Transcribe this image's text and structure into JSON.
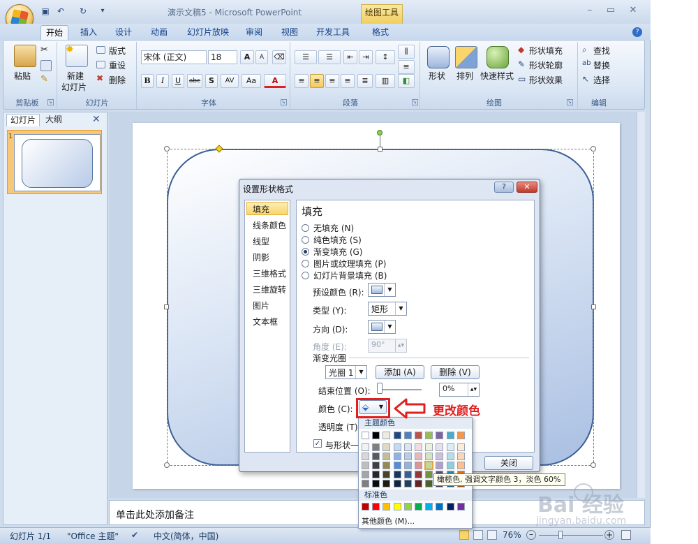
{
  "window": {
    "title": "演示文稿5 - Microsoft PowerPoint",
    "contextual_tool": "绘图工具",
    "controls": [
      "–",
      "▭",
      "✕"
    ]
  },
  "tabs": [
    "开始",
    "插入",
    "设计",
    "动画",
    "幻灯片放映",
    "审阅",
    "视图",
    "开发工具",
    "格式"
  ],
  "active_tab": "开始",
  "ribbon": {
    "clipboard": {
      "paste": "粘贴",
      "group": "剪贴板"
    },
    "slides": {
      "new_slide_line1": "新建",
      "new_slide_line2": "幻灯片",
      "layout": "版式",
      "reset": "重设",
      "delete": "删除",
      "group": "幻灯片"
    },
    "font": {
      "name": "宋体 (正文)",
      "size": "18",
      "group": "字体"
    },
    "paragraph": {
      "group": "段落"
    },
    "drawing": {
      "shape": "形状",
      "arrange": "排列",
      "quick_style": "快速样式",
      "fill": "形状填充",
      "outline": "形状轮廓",
      "effect": "形状效果",
      "group": "绘图"
    },
    "editing": {
      "find": "查找",
      "replace": "替换",
      "select": "选择",
      "group": "编辑"
    }
  },
  "left_pane": {
    "tab_slides": "幻灯片",
    "tab_outline": "大纲",
    "slide_number": "1"
  },
  "notes_placeholder": "单击此处添加备注",
  "status": {
    "slide": "幻灯片 1/1",
    "theme": "\"Office 主题\"",
    "language": "中文(简体，中国)",
    "zoom": "76%"
  },
  "dialog": {
    "title": "设置形状格式",
    "help": "?",
    "close_x": "✕",
    "nav": [
      "填充",
      "线条颜色",
      "线型",
      "阴影",
      "三维格式",
      "三维旋转",
      "图片",
      "文本框"
    ],
    "selected_nav": "填充",
    "heading": "填充",
    "radios": [
      "无填充 (N)",
      "纯色填充 (S)",
      "渐变填充 (G)",
      "图片或纹理填充 (P)",
      "幻灯片背景填充 (B)"
    ],
    "selected_radio": "渐变填充 (G)",
    "preset_label": "预设颜色 (R):",
    "type_label": "类型 (Y):",
    "type_value": "矩形",
    "direction_label": "方向 (D):",
    "angle_label": "角度 (E):",
    "angle_value": "90°",
    "stops_title": "渐变光圈",
    "stop_value": "光圈 1",
    "add_button": "添加 (A)",
    "delete_button": "删除 (V)",
    "end_pos_label": "结束位置 (O):",
    "end_pos_value": "0%",
    "end_pos_fraction": 0.0,
    "color_label": "颜色 (C):",
    "transparency_label": "透明度 (T):",
    "rotate_label": "与形状一",
    "close_button": "关闭"
  },
  "annotation": "更改颜色",
  "color_popup": {
    "theme_header": "主题颜色",
    "standard_header": "标准色",
    "more_colors": "其他颜色 (M)...",
    "tooltip": "橄榄色, 强调文字颜色 3，淡色 60%",
    "theme_top": [
      "#ffffff",
      "#000000",
      "#eeece1",
      "#1f497d",
      "#4f81bd",
      "#c0504d",
      "#9bbb59",
      "#8064a2",
      "#4bacc6",
      "#f79646"
    ],
    "theme_columns": [
      [
        "#f2f2f2",
        "#d8d8d8",
        "#bfbfbf",
        "#a5a5a5",
        "#7f7f7f"
      ],
      [
        "#7f7f7f",
        "#595959",
        "#3f3f3f",
        "#262626",
        "#0c0c0c"
      ],
      [
        "#ddd9c3",
        "#c4bd97",
        "#938953",
        "#494429",
        "#1d1b10"
      ],
      [
        "#c6d9f0",
        "#8db3e2",
        "#548dd4",
        "#17365d",
        "#0f243e"
      ],
      [
        "#dbe5f1",
        "#b8cce4",
        "#95b3d7",
        "#366092",
        "#244061"
      ],
      [
        "#f2dcdb",
        "#e5b9b7",
        "#d99694",
        "#953734",
        "#632423"
      ],
      [
        "#ebf1dd",
        "#d7e3bc",
        "#c3d69b",
        "#76923c",
        "#4f6128"
      ],
      [
        "#e5e0ec",
        "#ccc1d9",
        "#b2a2c7",
        "#5f497a",
        "#3f3151"
      ],
      [
        "#dbeef3",
        "#b7dde8",
        "#92cddc",
        "#31859b",
        "#205867"
      ],
      [
        "#fdeada",
        "#fbd5b5",
        "#fac08f",
        "#e36c09",
        "#974806"
      ]
    ],
    "standard": [
      "#c00000",
      "#ff0000",
      "#ffc000",
      "#ffff00",
      "#92d050",
      "#00b050",
      "#00b0f0",
      "#0070c0",
      "#002060",
      "#7030a0"
    ]
  },
  "watermark": {
    "brand": "Bai 经验",
    "url": "jingyan.baidu.com"
  },
  "colors": {
    "accent_red": "#e02020",
    "ribbon_blue": "#15428b"
  }
}
